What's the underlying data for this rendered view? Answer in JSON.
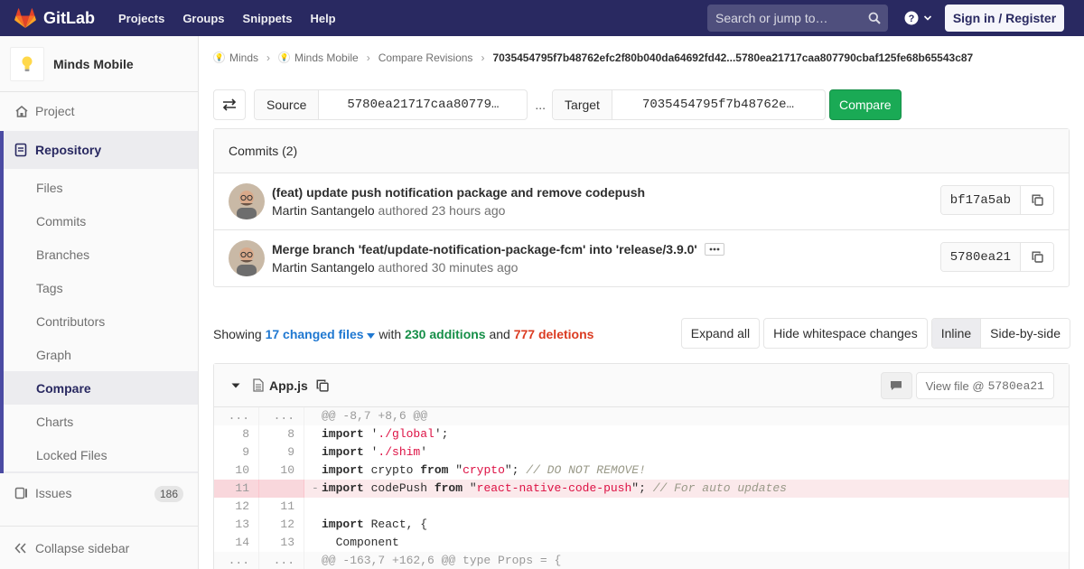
{
  "navbar": {
    "brand": "GitLab",
    "links": [
      "Projects",
      "Groups",
      "Snippets",
      "Help"
    ],
    "search_placeholder": "Search or jump to…",
    "signin_label": "Sign in / Register"
  },
  "sidebar": {
    "project_name": "Minds Mobile",
    "project_label": "Project",
    "repository_label": "Repository",
    "repo_items": [
      "Files",
      "Commits",
      "Branches",
      "Tags",
      "Contributors",
      "Graph",
      "Compare",
      "Charts",
      "Locked Files"
    ],
    "active_item": "Compare",
    "issues_label": "Issues",
    "issues_count": "186",
    "collapse_label": "Collapse sidebar"
  },
  "breadcrumb": {
    "items": [
      "Minds",
      "Minds Mobile",
      "Compare Revisions"
    ],
    "current": "7035454795f7b48762efc2f80b040da64692fd42...5780ea21717caa807790cbaf125fe68b65543c87"
  },
  "compare": {
    "source_label": "Source",
    "source_value": "5780ea21717caa80779…",
    "dots": "...",
    "target_label": "Target",
    "target_value": "7035454795f7b48762e…",
    "button_label": "Compare"
  },
  "commits": {
    "header": "Commits (2)",
    "items": [
      {
        "title": "(feat) update push notification package and remove codepush",
        "author": "Martin Santangelo",
        "meta": "authored 23 hours ago",
        "sha": "bf17a5ab"
      },
      {
        "title": "Merge branch 'feat/update-notification-package-fcm' into 'release/3.9.0'",
        "author": "Martin Santangelo",
        "meta": "authored 30 minutes ago",
        "sha": "5780ea21"
      }
    ]
  },
  "changes": {
    "showing": "Showing",
    "files": "17 changed files",
    "with": "with",
    "additions": "230 additions",
    "and": "and",
    "deletions": "777 deletions",
    "expand_all": "Expand all",
    "hide_whitespace": "Hide whitespace changes",
    "inline": "Inline",
    "side_by_side": "Side-by-side"
  },
  "file": {
    "name": "App.js",
    "view_file_label": "View file @",
    "view_file_sha": "5780ea21"
  },
  "diff_lines": [
    {
      "type": "match",
      "old": "...",
      "new": "...",
      "text": "@@ -8,7 +8,6 @@"
    },
    {
      "type": "ctx",
      "old": "8",
      "new": "8",
      "parts": [
        [
          "kw",
          "import"
        ],
        [
          "",
          " '"
        ],
        [
          "str",
          "./global"
        ],
        [
          "",
          "';"
        ]
      ]
    },
    {
      "type": "ctx",
      "old": "9",
      "new": "9",
      "parts": [
        [
          "kw",
          "import"
        ],
        [
          "",
          " '"
        ],
        [
          "str",
          "./shim"
        ],
        [
          "",
          "'"
        ]
      ]
    },
    {
      "type": "ctx",
      "old": "10",
      "new": "10",
      "parts": [
        [
          "kw",
          "import"
        ],
        [
          "",
          " crypto "
        ],
        [
          "kw",
          "from"
        ],
        [
          "",
          " \""
        ],
        [
          "str",
          "crypto"
        ],
        [
          "",
          "\"; "
        ],
        [
          "cmt",
          "// DO NOT REMOVE!"
        ]
      ]
    },
    {
      "type": "old",
      "old": "11",
      "new": "",
      "marker": "-",
      "parts": [
        [
          "kw",
          "import"
        ],
        [
          "",
          " codePush "
        ],
        [
          "kw",
          "from"
        ],
        [
          "",
          " \""
        ],
        [
          "str",
          "react-native-code-push"
        ],
        [
          "",
          "\"; "
        ],
        [
          "cmt",
          "// For auto updates"
        ]
      ]
    },
    {
      "type": "ctx",
      "old": "12",
      "new": "11",
      "parts": [
        [
          "",
          ""
        ]
      ]
    },
    {
      "type": "ctx",
      "old": "13",
      "new": "12",
      "parts": [
        [
          "kw",
          "import"
        ],
        [
          "",
          " React, {"
        ]
      ]
    },
    {
      "type": "ctx",
      "old": "14",
      "new": "13",
      "parts": [
        [
          "",
          "  Component"
        ]
      ]
    },
    {
      "type": "match",
      "old": "...",
      "new": "...",
      "text": "@@ -163,7 +162,6 @@ type Props = {"
    }
  ],
  "colors": {
    "navbar": "#292961",
    "sidebar_accent": "#4b4ba3",
    "compare_button": "#1aaa55",
    "link": "#1f78d1",
    "additions": "#168f48",
    "deletions": "#db3b21"
  }
}
